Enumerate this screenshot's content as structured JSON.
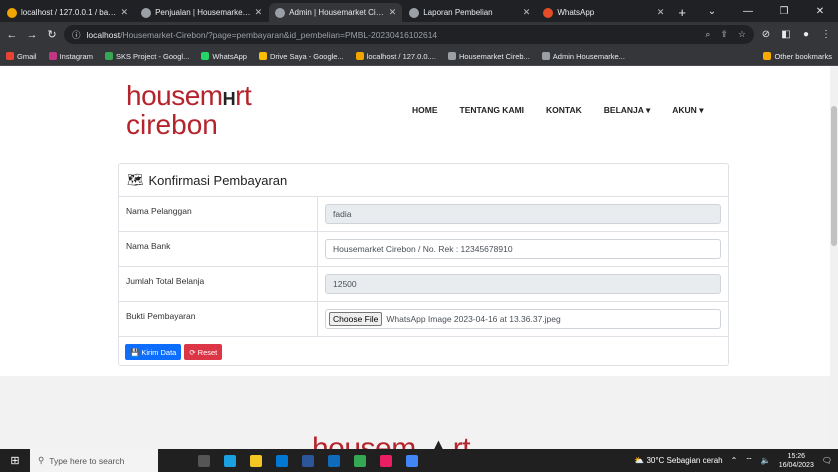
{
  "tabs": [
    {
      "title": "localhost / 127.0.0.1 / bahan",
      "color": "#f0a500",
      "active": false
    },
    {
      "title": "Penjualan | Housemarket Cire",
      "color": "#9aa0a6",
      "active": false
    },
    {
      "title": "Admin | Housemarket Cirebo",
      "color": "#9aa0a6",
      "active": true
    },
    {
      "title": "Laporan Pembelian",
      "color": "#9aa0a6",
      "active": false
    },
    {
      "title": "WhatsApp",
      "color": "#e44d26",
      "active": false
    }
  ],
  "addressbar": {
    "host": "localhost",
    "path": "/Housemarket-Cirebon/?page=pembayaran&id_pembelian=PMBL-20230416102614"
  },
  "bookmarks": [
    "Gmail",
    "Instagram",
    "SKS Project - Googl...",
    "WhatsApp",
    "Drive Saya - Google...",
    "localhost / 127.0.0....",
    "Housemarket Cireb...",
    "Admin Housemarke..."
  ],
  "bookmarks_other": "Other bookmarks",
  "logo": {
    "line1": "housem",
    "mid": "H",
    "line1b": "rt",
    "line2": "cirebon"
  },
  "nav": {
    "home": "HOME",
    "about": "TENTANG KAMI",
    "contact": "KONTAK",
    "shop": "BELANJA",
    "account": "AKUN"
  },
  "form": {
    "title": "Konfirmasi Pembayaran",
    "rows": [
      {
        "label": "Nama Pelanggan",
        "value": "fadia",
        "readonly": true
      },
      {
        "label": "Nama Bank",
        "value": "Housemarket Cirebon / No. Rek : 12345678910",
        "readonly": false
      },
      {
        "label": "Jumlah Total Belanja",
        "value": "12500",
        "readonly": true
      },
      {
        "label": "Bukti Pembayaran",
        "file_button": "Choose File",
        "file_name": "WhatsApp Image 2023-04-16 at 13.36.37.jpeg"
      }
    ],
    "submit_label": "Kirim Data",
    "reset_label": "Reset"
  },
  "footer": {
    "logo_text": "housem",
    "logo_text_b": "rt"
  },
  "taskbar": {
    "search_placeholder": "Type here to search",
    "weather": "30°C  Sebagian cerah",
    "time": "15:26",
    "date": "16/04/2023"
  }
}
